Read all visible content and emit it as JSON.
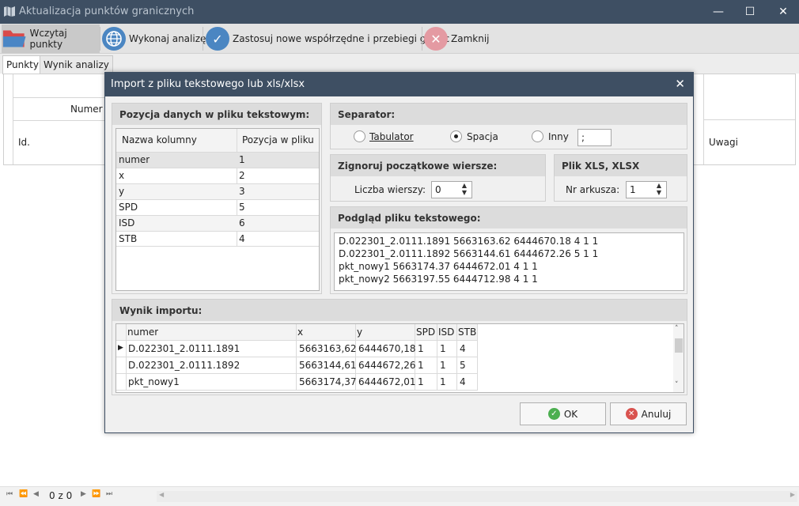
{
  "window": {
    "title": "Aktualizacja punktów granicznych",
    "minimize": "—",
    "maximize": "☐",
    "close": "✕"
  },
  "toolbar": {
    "load_label": "Wczytaj punkty",
    "analyze_label": "Wykonaj analizę",
    "apply_label": "Zastosuj nowe współrzędne i przebiegi granic",
    "close_label": "Zamknij"
  },
  "tabs": [
    "Punkty",
    "Wynik analizy"
  ],
  "grid": {
    "numer_header": "Numer",
    "id_header": "Id.",
    "uwagi_header": "Uwagi"
  },
  "status": {
    "page": "0 z 0"
  },
  "dialog": {
    "title": "Import z pliku tekstowego lub xls/xlsx",
    "close": "✕",
    "position": {
      "heading": "Pozycja danych w pliku tekstowym:",
      "col_name": "Nazwa kolumny",
      "col_pos": "Pozycja w pliku",
      "rows": [
        {
          "name": "numer",
          "pos": "1"
        },
        {
          "name": "x",
          "pos": "2"
        },
        {
          "name": "y",
          "pos": "3"
        },
        {
          "name": "SPD",
          "pos": "5"
        },
        {
          "name": "ISD",
          "pos": "6"
        },
        {
          "name": "STB",
          "pos": "4"
        }
      ]
    },
    "separator": {
      "heading": "Separator:",
      "tab_label": "Tabulator",
      "space_label": "Spacja",
      "other_label": "Inny",
      "other_value": ";",
      "selected": "Spacja"
    },
    "ignore": {
      "heading": "Zignoruj początkowe wiersze:",
      "label": "Liczba wierszy:",
      "value": "0"
    },
    "xls": {
      "heading": "Plik XLS, XLSX",
      "label": "Nr arkusza:",
      "value": "1"
    },
    "preview": {
      "heading": "Podgląd pliku tekstowego:",
      "lines": [
        "D.022301_2.0111.1891 5663163.62 6444670.18 4 1 1",
        "D.022301_2.0111.1892 5663144.61 6444672.26 5 1 1",
        "pkt_nowy1 5663174.37 6444672.01 4 1 1",
        "pkt_nowy2 5663197.55 6444712.98 4 1 1"
      ]
    },
    "result": {
      "heading": "Wynik importu:",
      "columns": [
        "numer",
        "x",
        "y",
        "SPD",
        "ISD",
        "STB"
      ],
      "rows": [
        [
          "D.022301_2.0111.1891",
          "5663163,62",
          "6444670,18",
          "1",
          "1",
          "4"
        ],
        [
          "D.022301_2.0111.1892",
          "5663144,61",
          "6444672,26",
          "1",
          "1",
          "5"
        ],
        [
          "pkt_nowy1",
          "5663174,37",
          "6444672,01",
          "1",
          "1",
          "4"
        ]
      ]
    },
    "ok_label": "OK",
    "cancel_label": "Anuluj"
  }
}
